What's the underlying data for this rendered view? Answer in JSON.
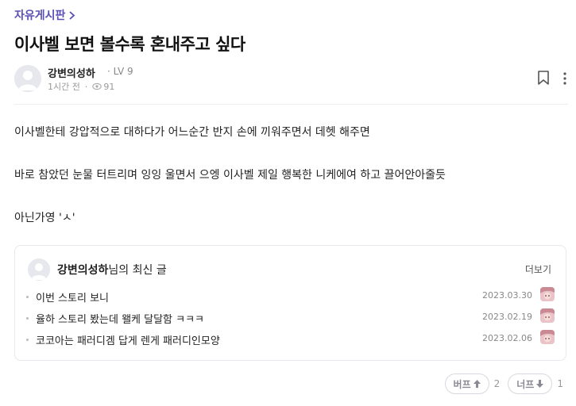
{
  "breadcrumb": {
    "board_name": "자유게시판"
  },
  "post": {
    "title": "이사벨 보면 볼수록 혼내주고 싶다",
    "author": "강변의성하",
    "level": "LV 9",
    "time": "1시간 전",
    "views": "91",
    "body": [
      "이사벨한테 강압적으로 대하다가 어느순간 반지 손에 끼워주면서 데헷 해주면",
      "바로 참았던 눈물 터트리며 잉잉 울면서 으엥 이사벨 제일 행복한 니케에여 하고 끌어안아줄듯",
      "아닌가영 'ㅅ'"
    ]
  },
  "latest": {
    "author": "강변의성하",
    "suffix": "님의 최신 글",
    "more_label": "더보기",
    "items": [
      {
        "title": "이번 스토리 보니",
        "date": "2023.03.30"
      },
      {
        "title": "율하 스토리 봤는데 왤케 달달함 ㅋㅋㅋ",
        "date": "2023.02.19"
      },
      {
        "title": "코코아는 패러디겜 답게 렌게 패러디인모양",
        "date": "2023.02.06"
      }
    ]
  },
  "votes": {
    "up_label": "버프",
    "up_count": "2",
    "down_label": "너프",
    "down_count": "1"
  },
  "colors": {
    "accent": "#5b4fb5",
    "text": "#222222",
    "muted": "#999999"
  }
}
